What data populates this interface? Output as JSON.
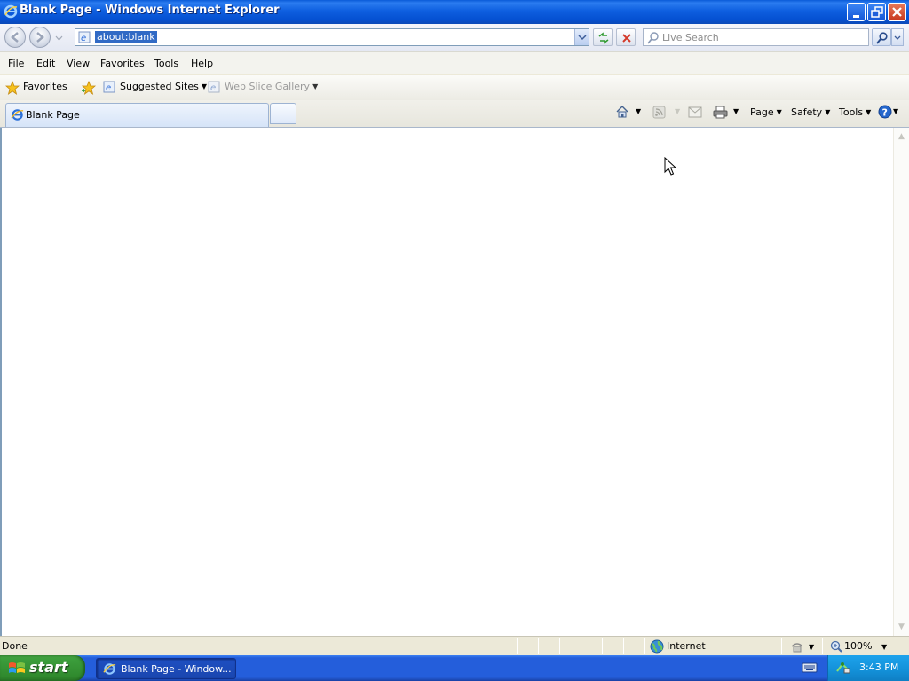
{
  "window": {
    "title": "Blank Page - Windows Internet Explorer",
    "buttons": {
      "minimize": "minimize",
      "maximize": "restore",
      "close": "close"
    }
  },
  "address_bar": {
    "url": "about:blank"
  },
  "search": {
    "placeholder": "Live Search"
  },
  "menu": [
    "File",
    "Edit",
    "View",
    "Favorites",
    "Tools",
    "Help"
  ],
  "favorites_bar": {
    "favorites_label": "Favorites",
    "suggested_sites": "Suggested Sites",
    "web_slice_gallery": "Web Slice Gallery"
  },
  "tabs": [
    {
      "label": "Blank Page",
      "active": true
    }
  ],
  "command_bar": {
    "page": "Page",
    "safety": "Safety",
    "tools": "Tools"
  },
  "status_bar": {
    "status": "Done",
    "zone": "Internet",
    "zoom": "100%"
  },
  "taskbar": {
    "start_label": "start",
    "task_item": "Blank Page - Window...",
    "clock": "3:43 PM"
  },
  "colors": {
    "titlebar": "#0a5bd8",
    "taskbar": "#245edb",
    "start_button": "#3c9e3c",
    "selection": "#316ac5"
  }
}
